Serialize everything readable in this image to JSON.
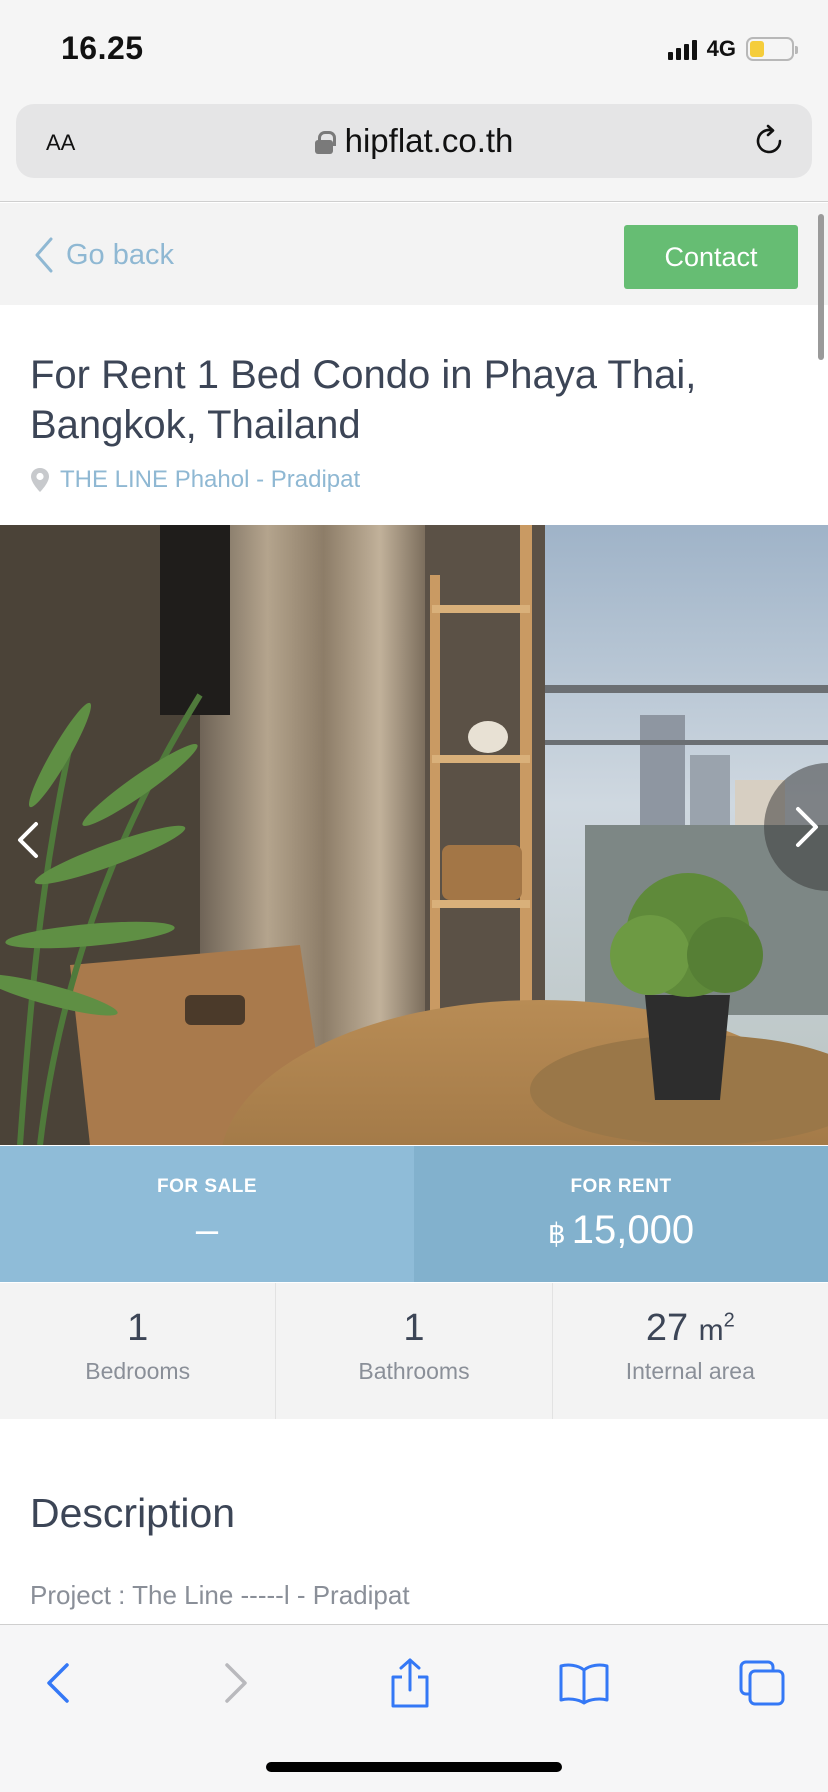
{
  "status_bar": {
    "time": "16.25",
    "network": "4G",
    "battery_level": 0.35
  },
  "browser": {
    "text_size_label": "AA",
    "url": "hipflat.co.th"
  },
  "header": {
    "back_label": "Go back",
    "contact_label": "Contact"
  },
  "listing": {
    "title": "For Rent 1 Bed Condo in Phaya Thai, Bangkok, Thailand",
    "project": "THE LINE Phahol - Pradipat"
  },
  "prices": {
    "sale_label": "FOR SALE",
    "sale_value": "–",
    "rent_label": "FOR RENT",
    "currency_symbol": "฿",
    "rent_value": "15,000"
  },
  "stats": {
    "bedrooms_value": "1",
    "bedrooms_label": "Bedrooms",
    "bathrooms_value": "1",
    "bathrooms_label": "Bathrooms",
    "area_value": "27",
    "area_unit": "m",
    "area_unit_exp": "2",
    "area_label": "Internal area"
  },
  "description": {
    "heading": "Description",
    "first_line": "Project : The Line -----l - Pradipat"
  },
  "colors": {
    "contact_green": "#66bd73",
    "link_blue": "#8fb8d3",
    "sale_bg": "#8fbcd8",
    "rent_bg": "#82b1cd",
    "toolbar_blue": "#3478f6"
  }
}
